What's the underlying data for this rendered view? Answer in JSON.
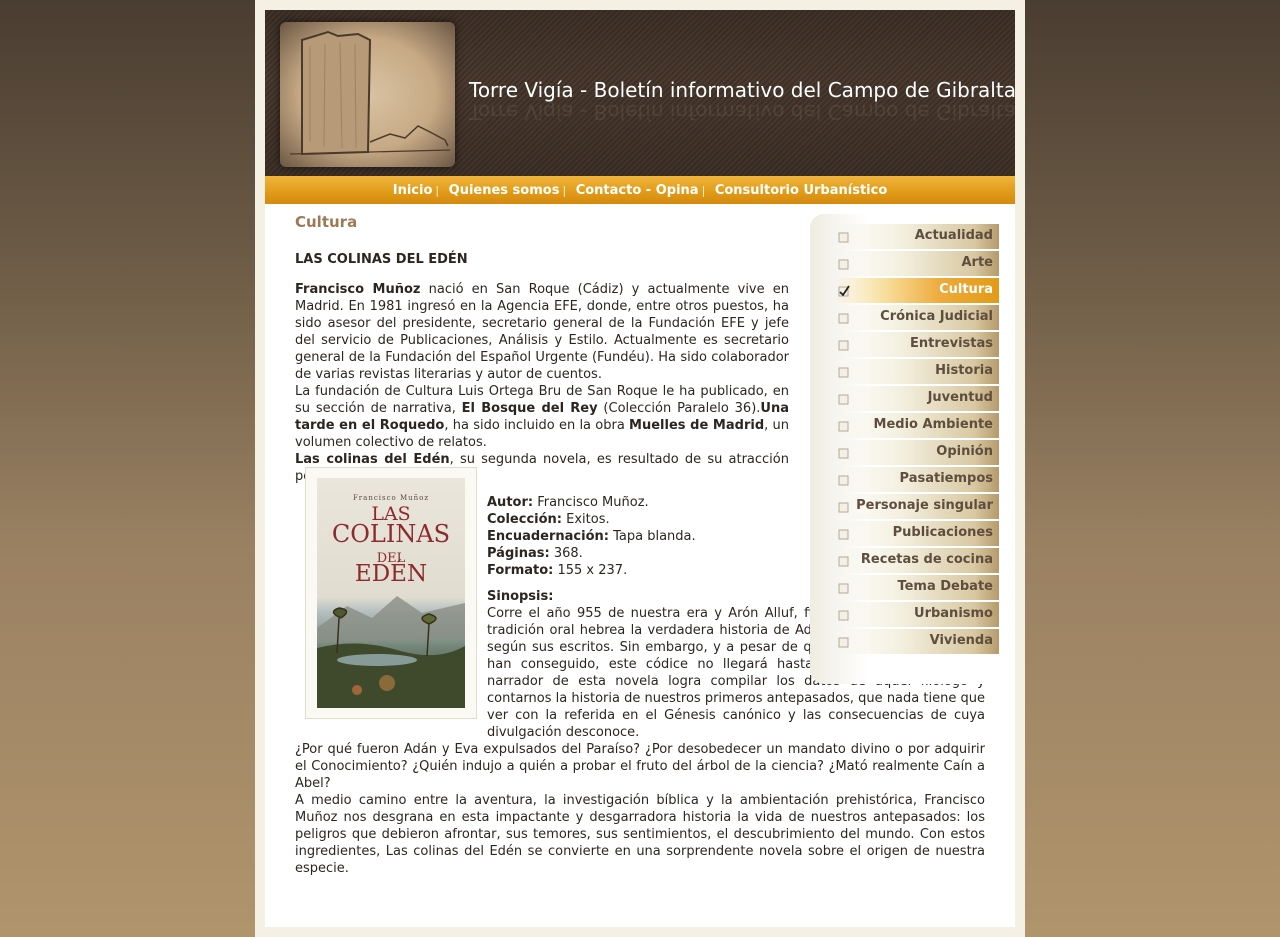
{
  "header": {
    "site_title": "Torre Vigía - Boletín informativo del Campo de Gibraltar"
  },
  "nav": {
    "items": [
      {
        "label": "Inicio"
      },
      {
        "label": "Quienes somos"
      },
      {
        "label": "Contacto - Opina"
      },
      {
        "label": "Consultorio Urbanístico"
      }
    ],
    "separator": "|"
  },
  "main": {
    "section_title": "Cultura",
    "article_title": "LAS COLINAS DEL EDÉN",
    "intro": {
      "author_name": "Francisco Muñoz",
      "p1": " nació en San Roque (Cádiz) y actualmente vive en Madrid. En 1981 ingresó en la Agencia EFE, donde, entre otros puestos, ha sido asesor del presidente, secretario general de la Fundación EFE y jefe del servicio de Publicaciones, Análisis y Estilo. Actualmente es secretario general de la Fundación del Español Urgente (Fundéu). Ha sido colaborador de varias revistas literarias y autor de cuentos.",
      "p2_a": "La fundación de Cultura Luis Ortega Bru de San Roque le ha publicado, en su sección de narrativa, ",
      "p2_b": "El Bosque del Rey",
      "p2_c": " (Colección Paralelo 36).",
      "p2_d": "Una tarde en el Roquedo",
      "p2_e": ", ha sido incluido en la obra ",
      "p2_f": "Muelles de Madrid",
      "p2_g": ", un volumen colectivo de relatos.",
      "p3_a": "Las colinas del Edén",
      "p3_b": ", su segunda novela, es resultado de su atracción por el mundo bíblico."
    },
    "cover": {
      "author": "Francisco Muñoz",
      "line1": "LAS",
      "line2": "COLINAS",
      "line3": "DEL",
      "line4": "EDÉN"
    },
    "meta": [
      {
        "label": "Autor:",
        "value": " Francisco Muñoz."
      },
      {
        "label": "Colección:",
        "value": " Exitos."
      },
      {
        "label": "Encuadernación:",
        "value": " Tapa blanda."
      },
      {
        "label": "Páginas:",
        "value": " 368."
      },
      {
        "label": "Formato:",
        "value": " 155 x 237."
      }
    ],
    "sinopsis_label": "Sinopsis:",
    "sinopsis_1": "Corre el año 955 de nuestra era y Arón Alluf, filólogo judío, recoge de la tradición oral hebrea la verdadera historia de Adán y Eva, Adam y Havvah según sus escritos. Sin embargo, y a pesar de que otros documentos sí lo han conseguido, este códice no llegará hasta nuestros días... Solo el narrador de esta novela logra compilar los datos de aquel filólogo y contarnos la historia de nuestros primeros antepasados, que nada tiene que ver con la referida en el Génesis canónico y las consecuencias de cuya divulgación desconoce.",
    "sinopsis_2": "¿Por qué fueron Adán y Eva expulsados del Paraíso? ¿Por desobedecer un mandato divino o por adquirir el Conocimiento? ¿Quién indujo a quién a probar el fruto del árbol de la ciencia? ¿Mató realmente Caín a Abel?",
    "sinopsis_3": "A medio camino entre la aventura, la investigación bíblica y la ambientación prehistórica, Francisco Muñoz nos desgrana en esta impactante y desgarradora historia la vida de nuestros antepasados: los peligros que debieron afrontar, sus temores, sus sentimientos, el descubrimiento del mundo. Con estos ingredientes, Las colinas del Edén se convierte en una sorprendente novela sobre el origen de nuestra especie."
  },
  "sidebar": {
    "items": [
      {
        "label": "Actualidad"
      },
      {
        "label": "Arte"
      },
      {
        "label": "Cultura"
      },
      {
        "label": "Crónica Judicial"
      },
      {
        "label": "Entrevistas"
      },
      {
        "label": "Historia"
      },
      {
        "label": "Juventud"
      },
      {
        "label": "Medio Ambiente"
      },
      {
        "label": "Opinión"
      },
      {
        "label": "Pasatiempos"
      },
      {
        "label": "Personaje singular"
      },
      {
        "label": "Publicaciones"
      },
      {
        "label": "Recetas de cocina"
      },
      {
        "label": "Tema Debate"
      },
      {
        "label": "Urbanismo"
      },
      {
        "label": "Vivienda"
      }
    ],
    "active": "Cultura"
  },
  "colors": {
    "nav_orange": "#e09a18",
    "header_brown": "#3e3027",
    "section_title": "#9b7a58"
  }
}
